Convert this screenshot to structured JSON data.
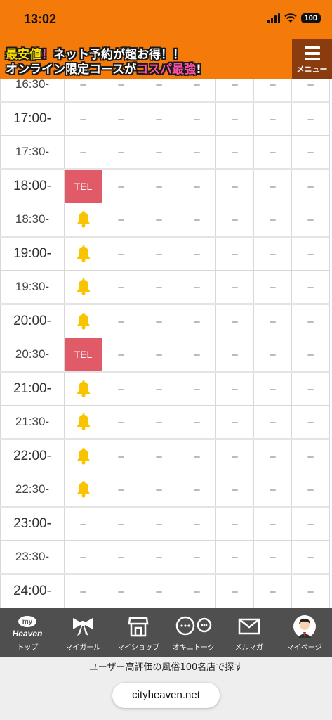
{
  "status_bar": {
    "time": "13:02",
    "battery": "100"
  },
  "banner": {
    "line1_a": "最安値",
    "line1_b": "！",
    "line1_c": "ネット予約が超お得！！",
    "line2_a": "オンライン限定コースが",
    "line2_b": "コスパ最強",
    "line2_c": "!"
  },
  "menu": {
    "label": "メニュー"
  },
  "schedule": {
    "rows": [
      {
        "time": "16:30-",
        "cells": [
          "–",
          "–",
          "–",
          "–",
          "–",
          "–",
          "–"
        ]
      },
      {
        "time": "17:00-",
        "cells": [
          "–",
          "–",
          "–",
          "–",
          "–",
          "–",
          "–"
        ]
      },
      {
        "time": "17:30-",
        "cells": [
          "–",
          "–",
          "–",
          "–",
          "–",
          "–",
          "–"
        ]
      },
      {
        "time": "18:00-",
        "cells": [
          "TEL",
          "–",
          "–",
          "–",
          "–",
          "–",
          "–"
        ]
      },
      {
        "time": "18:30-",
        "cells": [
          "bell",
          "–",
          "–",
          "–",
          "–",
          "–",
          "–"
        ]
      },
      {
        "time": "19:00-",
        "cells": [
          "bell",
          "–",
          "–",
          "–",
          "–",
          "–",
          "–"
        ]
      },
      {
        "time": "19:30-",
        "cells": [
          "bell",
          "–",
          "–",
          "–",
          "–",
          "–",
          "–"
        ]
      },
      {
        "time": "20:00-",
        "cells": [
          "bell",
          "–",
          "–",
          "–",
          "–",
          "–",
          "–"
        ]
      },
      {
        "time": "20:30-",
        "cells": [
          "TEL",
          "–",
          "–",
          "–",
          "–",
          "–",
          "–"
        ]
      },
      {
        "time": "21:00-",
        "cells": [
          "bell",
          "–",
          "–",
          "–",
          "–",
          "–",
          "–"
        ]
      },
      {
        "time": "21:30-",
        "cells": [
          "bell",
          "–",
          "–",
          "–",
          "–",
          "–",
          "–"
        ]
      },
      {
        "time": "22:00-",
        "cells": [
          "bell",
          "–",
          "–",
          "–",
          "–",
          "–",
          "–"
        ]
      },
      {
        "time": "22:30-",
        "cells": [
          "bell",
          "–",
          "–",
          "–",
          "–",
          "–",
          "–"
        ]
      },
      {
        "time": "23:00-",
        "cells": [
          "–",
          "–",
          "–",
          "–",
          "–",
          "–",
          "–"
        ]
      },
      {
        "time": "23:30-",
        "cells": [
          "–",
          "–",
          "–",
          "–",
          "–",
          "–",
          "–"
        ]
      },
      {
        "time": "24:00-",
        "cells": [
          "–",
          "–",
          "–",
          "–",
          "–",
          "–",
          "–"
        ]
      },
      {
        "time": "",
        "cells": [
          "",
          "",
          "",
          "",
          "",
          "",
          ""
        ]
      }
    ]
  },
  "bottom_nav": {
    "items": [
      {
        "label": "トップ",
        "icon": "my-heaven-icon",
        "logo_top": "my",
        "logo_bottom": "Heaven"
      },
      {
        "label": "マイガール",
        "icon": "ribbon-icon"
      },
      {
        "label": "マイショップ",
        "icon": "shop-icon"
      },
      {
        "label": "オキニトーク",
        "icon": "chat-bubbles-icon"
      },
      {
        "label": "メルマガ",
        "icon": "mail-icon"
      },
      {
        "label": "マイページ",
        "icon": "avatar-icon"
      }
    ]
  },
  "footer": {
    "text": "ユーザー高評価の風俗100名店で探す",
    "url": "cityheaven.net"
  },
  "colors": {
    "brand_orange": "#f47a0a",
    "menu_brown": "#8a3c0e",
    "tel_red": "#e05a67",
    "bell_yellow": "#f8c400",
    "nav_gray": "#4f4f4f"
  }
}
